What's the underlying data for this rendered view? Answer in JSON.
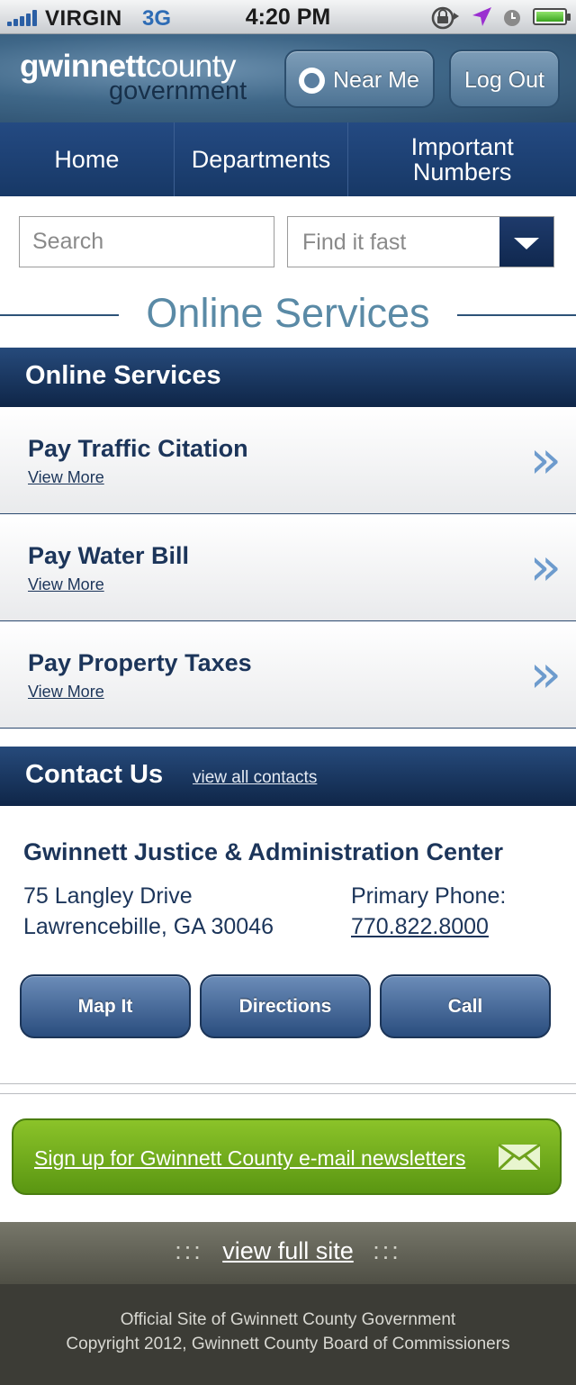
{
  "status_bar": {
    "carrier": "VIRGIN",
    "network": "3G",
    "time": "4:20 PM",
    "icons": [
      "signal-bars-icon",
      "rotation-lock-icon",
      "location-arrow-icon",
      "alarm-icon",
      "battery-icon"
    ]
  },
  "header": {
    "logo_line1_bold": "gwinnett",
    "logo_line1_light": "county",
    "logo_line2": "government",
    "near_me_label": "Near Me",
    "logout_label": "Log Out"
  },
  "nav": {
    "tabs": [
      {
        "label": "Home"
      },
      {
        "label": "Departments"
      },
      {
        "label": "Important Numbers"
      }
    ]
  },
  "search": {
    "placeholder": "Search",
    "findit_value": "Find it fast"
  },
  "section_title": "Online Services",
  "online_services": {
    "heading": "Online Services",
    "items": [
      {
        "title": "Pay Traffic Citation",
        "link": "View More"
      },
      {
        "title": "Pay Water Bill",
        "link": "View More"
      },
      {
        "title": "Pay Property Taxes",
        "link": "View More"
      }
    ],
    "chevron": "»"
  },
  "contact": {
    "heading": "Contact Us",
    "view_all": "view all contacts",
    "name": "Gwinnett Justice & Administration Center",
    "address_line1": "75 Langley Drive",
    "address_line2": "Lawrencebille, GA 30046",
    "phone_label": "Primary Phone:",
    "phone_number": "770.822.8000",
    "buttons": [
      {
        "label": "Map It"
      },
      {
        "label": "Directions"
      },
      {
        "label": "Call"
      }
    ]
  },
  "newsletter": {
    "label": "Sign up for Gwinnett County e-mail newsletters"
  },
  "footer": {
    "dots": ":::",
    "full_site": "view full site",
    "line1": "Official Site of Gwinnett County Government",
    "line2": "Copyright 2012, Gwinnett County Board of Commissioners"
  },
  "colors": {
    "navy": "#173866",
    "accent_blue": "#5a8aa6",
    "green": "#6fa91d",
    "footer_dark": "#3c3c36"
  }
}
